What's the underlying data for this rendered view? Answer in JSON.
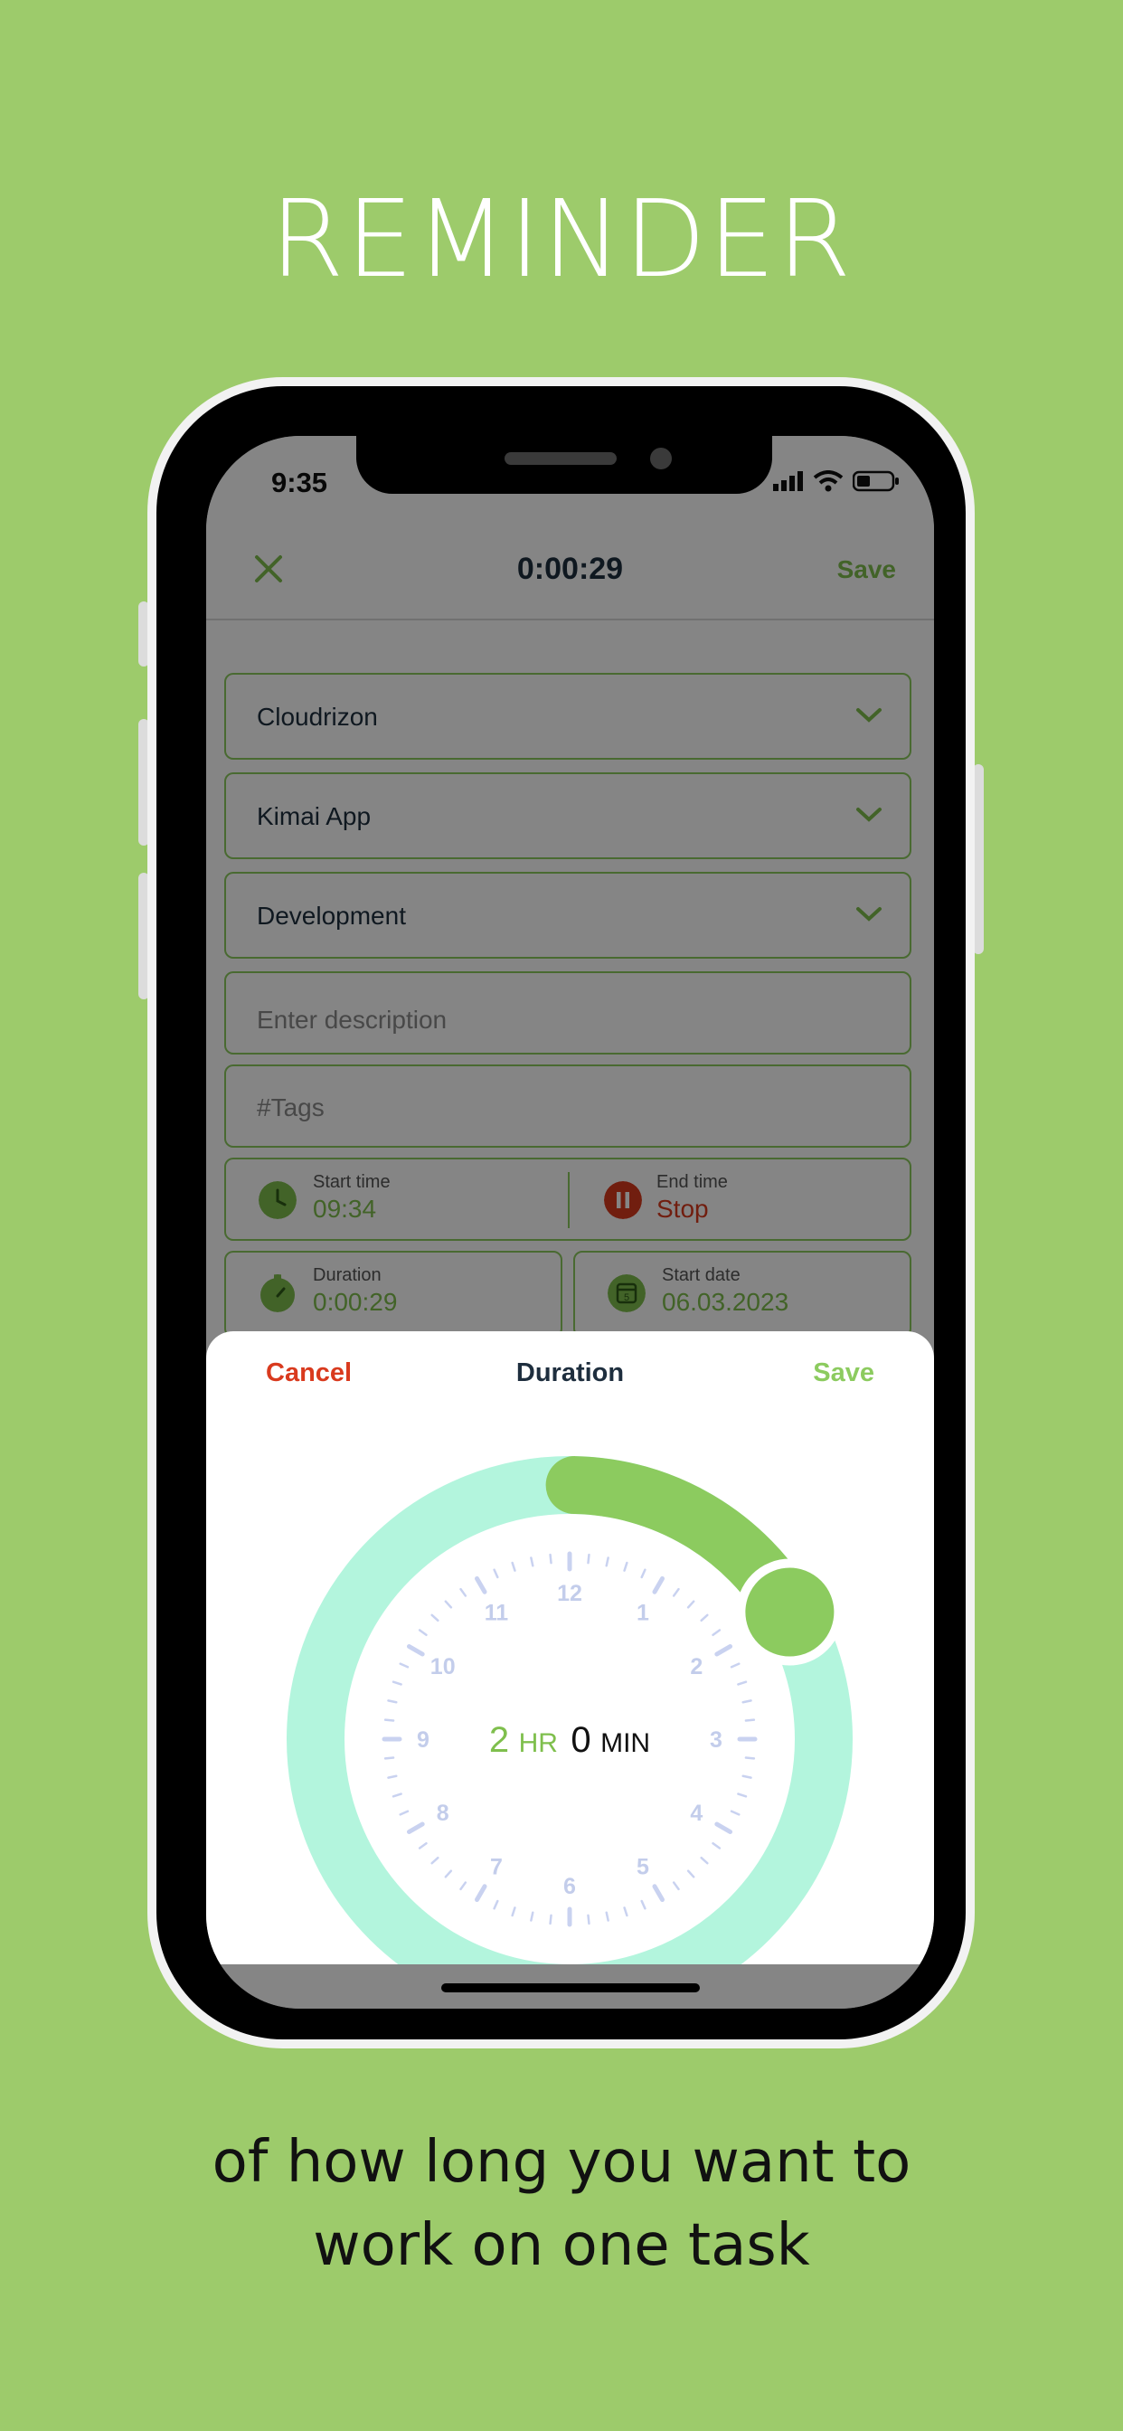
{
  "headline": "REMINDER",
  "tagline": [
    "of how long you want to",
    "work on one task"
  ],
  "colors": {
    "background": "#9dcb6b",
    "accent": "#8ccb5f",
    "danger": "#d93a1e",
    "ring": "#b3f5dd",
    "navy": "#1e2e3e"
  },
  "status_bar": {
    "time": "9:35",
    "icons": [
      "signal-icon",
      "wifi-icon",
      "battery-icon"
    ]
  },
  "app_bar": {
    "close_icon": "close-icon",
    "timer": "0:00:29",
    "save_label": "Save"
  },
  "form": {
    "customer": {
      "value": "Cloudrizon",
      "icon": "chevron-down-icon"
    },
    "project": {
      "value": "Kimai App",
      "icon": "chevron-down-icon"
    },
    "activity": {
      "value": "Development",
      "icon": "chevron-down-icon"
    },
    "description": {
      "placeholder": "Enter description"
    },
    "tags": {
      "placeholder": "#Tags"
    },
    "start_time": {
      "label": "Start time",
      "value": "09:34",
      "icon": "clock-icon"
    },
    "end_time": {
      "label": "End time",
      "value": "Stop",
      "icon": "pause-icon"
    },
    "duration": {
      "label": "Duration",
      "value": "0:00:29",
      "icon": "stopwatch-icon"
    },
    "start_date": {
      "label": "Start date",
      "value": "06.03.2023",
      "icon": "calendar-icon",
      "calendar_day": "5"
    }
  },
  "duration_sheet": {
    "cancel_label": "Cancel",
    "title": "Duration",
    "save_label": "Save",
    "hours": "2",
    "hours_unit": "HR",
    "minutes": "0",
    "minutes_unit": "MIN",
    "selected_fraction_of_12h": 0.1667,
    "dial_numbers": [
      "12",
      "1",
      "2",
      "3",
      "4",
      "5",
      "6",
      "7",
      "8",
      "9",
      "10",
      "11"
    ]
  }
}
